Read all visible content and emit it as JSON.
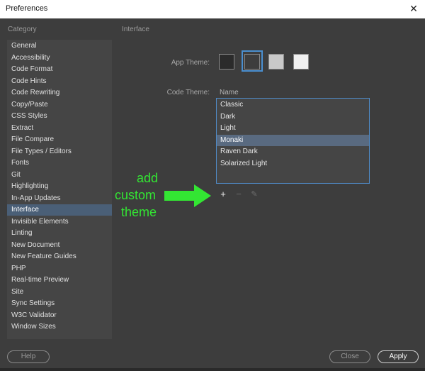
{
  "window": {
    "title": "Preferences",
    "close_glyph": "✕"
  },
  "category": {
    "header": "Category",
    "items": [
      {
        "label": "General"
      },
      {
        "label": "Accessibility"
      },
      {
        "label": "Code Format"
      },
      {
        "label": "Code Hints"
      },
      {
        "label": "Code Rewriting"
      },
      {
        "label": "Copy/Paste"
      },
      {
        "label": "CSS Styles"
      },
      {
        "label": "Extract"
      },
      {
        "label": "File Compare"
      },
      {
        "label": "File Types / Editors"
      },
      {
        "label": "Fonts"
      },
      {
        "label": "Git"
      },
      {
        "label": "Highlighting"
      },
      {
        "label": "In-App Updates"
      },
      {
        "label": "Interface",
        "selected": true
      },
      {
        "label": "Invisible Elements"
      },
      {
        "label": "Linting"
      },
      {
        "label": "New Document"
      },
      {
        "label": "New Feature Guides"
      },
      {
        "label": "PHP"
      },
      {
        "label": "Real-time Preview"
      },
      {
        "label": "Site"
      },
      {
        "label": "Sync Settings"
      },
      {
        "label": "W3C Validator"
      },
      {
        "label": "Window Sizes"
      }
    ]
  },
  "interface": {
    "section_title": "Interface",
    "app_theme_label": "App Theme:",
    "app_themes": [
      {
        "color": "#2b2b2b"
      },
      {
        "color": "#3d3d3d",
        "selected": true
      },
      {
        "color": "#c9c9c9"
      },
      {
        "color": "#f0f0f0"
      }
    ],
    "code_theme_label": "Code Theme:",
    "name_column_header": "Name",
    "code_themes": [
      {
        "label": "Classic"
      },
      {
        "label": "Dark"
      },
      {
        "label": "Light"
      },
      {
        "label": "Monaki",
        "selected": true
      },
      {
        "label": "Raven Dark"
      },
      {
        "label": "Solarized Light"
      }
    ],
    "tools": {
      "add_glyph": "+",
      "remove_glyph": "−",
      "edit_glyph": "✎"
    }
  },
  "annotation": {
    "lines": [
      "add",
      "custom",
      "theme"
    ],
    "color": "#33e533"
  },
  "footer": {
    "help_label": "Help",
    "close_label": "Close",
    "apply_label": "Apply"
  },
  "colors": {
    "background": "#3d3d3d",
    "list_background": "#454545",
    "selection": "#4a5f77",
    "accent_border": "#4f89c4"
  }
}
